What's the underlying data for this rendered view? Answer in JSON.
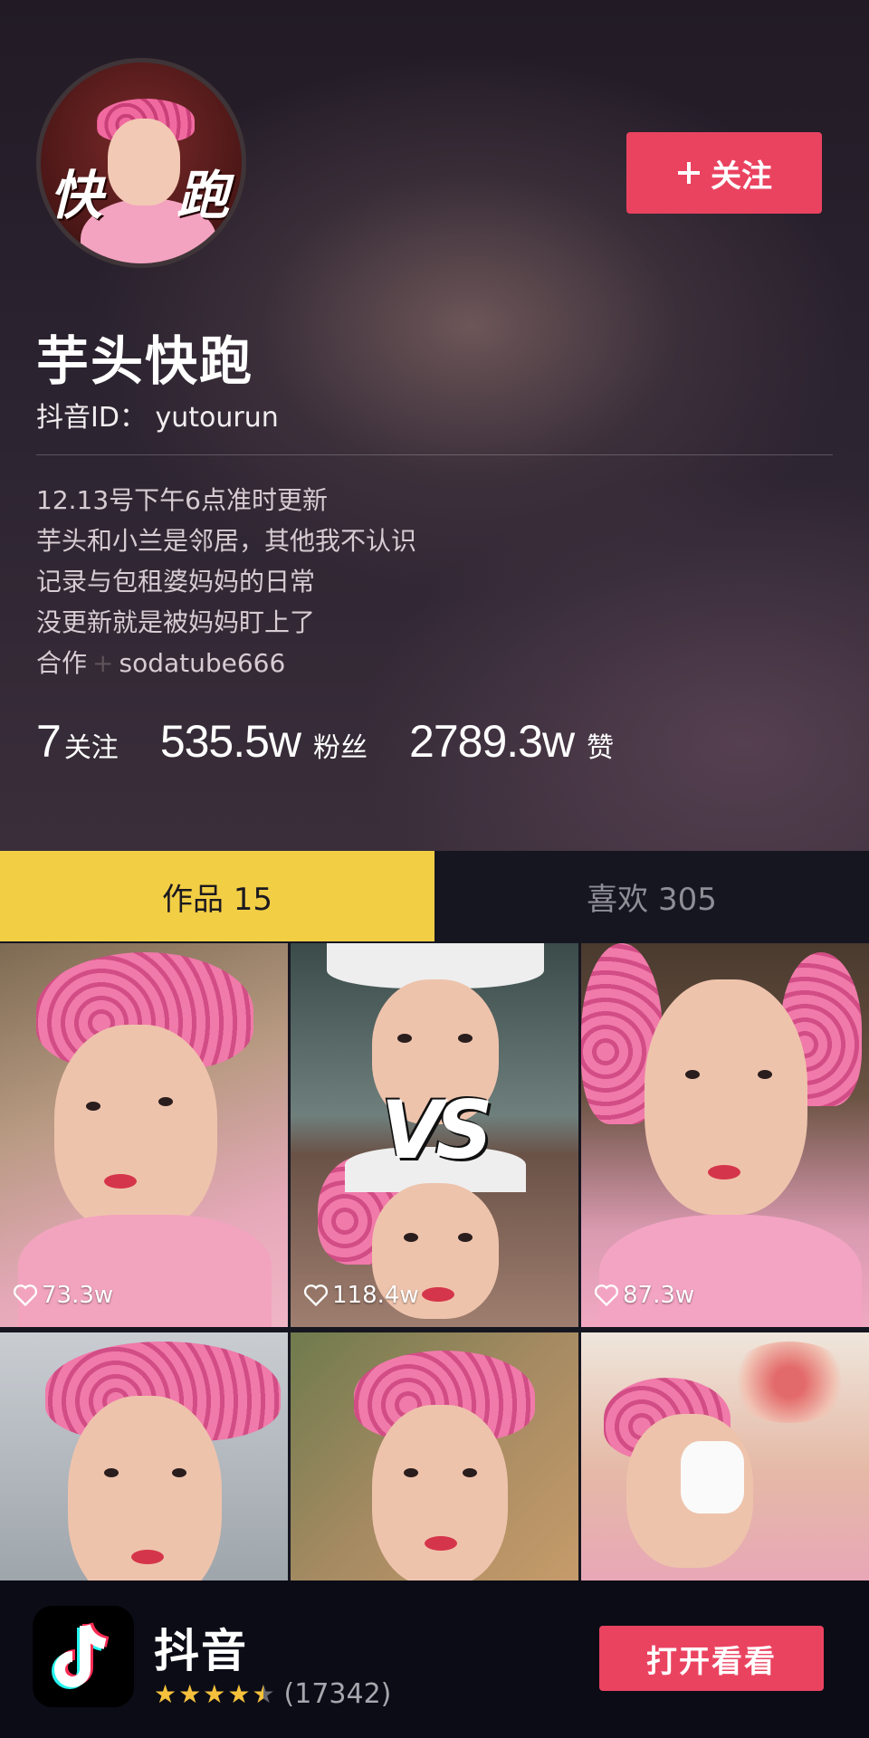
{
  "profile": {
    "avatar_text_left": "快",
    "avatar_text_right": "跑",
    "nickname": "芋头快跑",
    "douyin_id": "抖音ID： yutourun",
    "follow_button": "关注",
    "bio_lines": [
      "12.13号下午6点准时更新",
      "芋头和小兰是邻居，其他我不认识",
      "记录与包租婆妈妈的日常",
      "没更新就是被妈妈盯上了"
    ],
    "cooperation_label": "合作",
    "cooperation_plus": "+",
    "cooperation_value": "sodatube666"
  },
  "stats": {
    "following_num": "7",
    "following_label": "关注",
    "fans_num": "535.5w",
    "fans_label": "粉丝",
    "likes_num": "2789.3w",
    "likes_label": "赞"
  },
  "tabs": {
    "works": "作品 15",
    "likes": "喜欢 305"
  },
  "videos": [
    {
      "likes": "73.3w"
    },
    {
      "likes": "118.4w",
      "overlay": "VS"
    },
    {
      "likes": "87.3w"
    },
    {},
    {},
    {}
  ],
  "banner": {
    "app_name": "抖音",
    "rating_count": "(17342)",
    "rating_stars": 4.5,
    "open_button": "打开看看"
  },
  "colors": {
    "accent": "#ea4360",
    "tab_active": "#f2ce45",
    "star": "#f5c13d"
  }
}
